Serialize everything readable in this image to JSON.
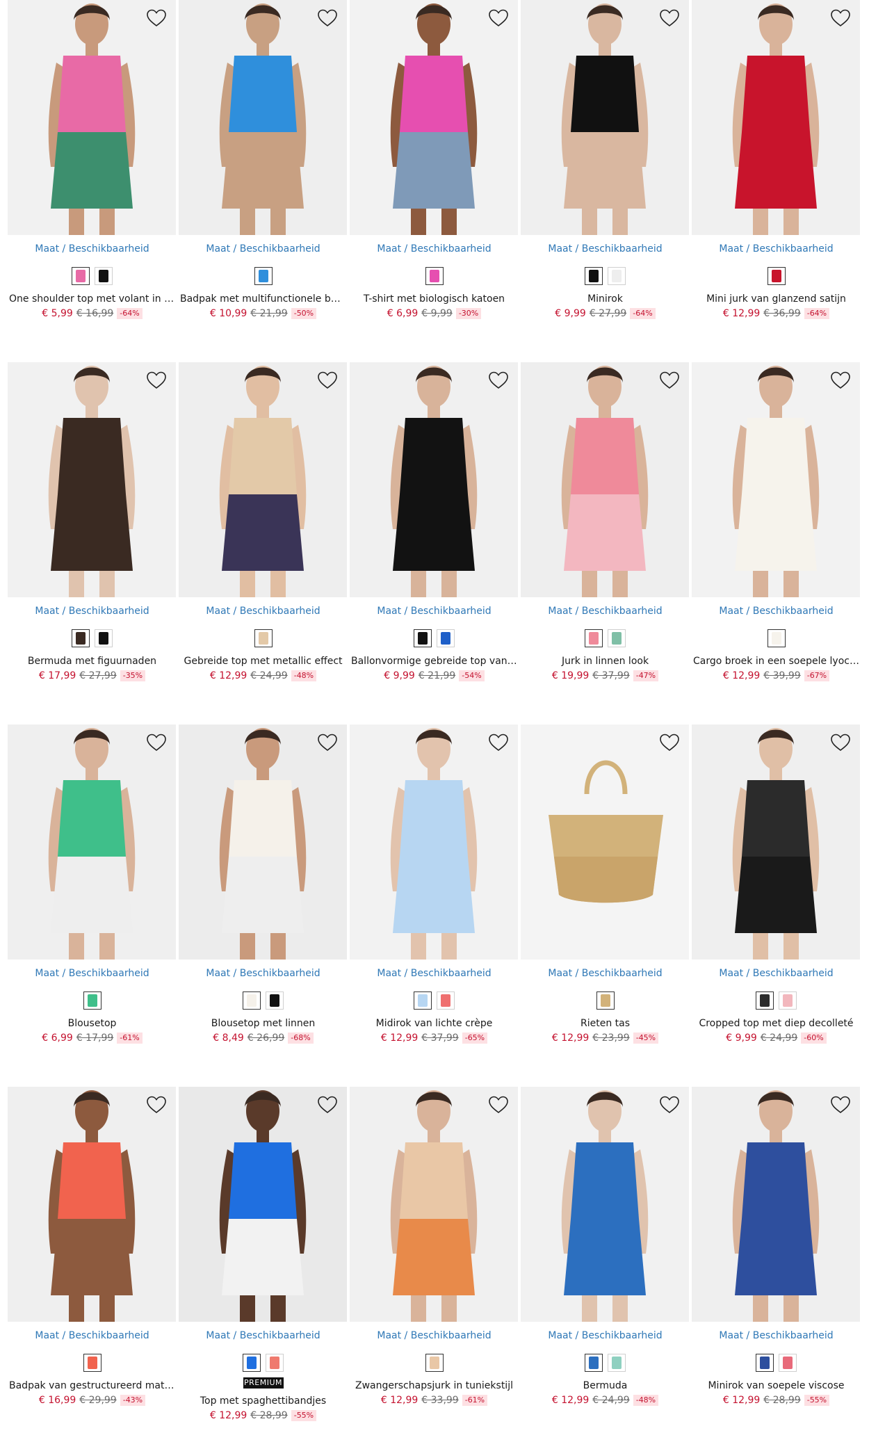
{
  "labels": {
    "size_availability": "Maat / Beschikbaarheid",
    "premium": "PREMIUM"
  },
  "colors": {
    "link": "#2f78b6",
    "sale_price": "#c4122f",
    "discount_bg": "#fde0e3"
  },
  "products": [
    {
      "name": "One shoulder top met volant in een...",
      "price": "€ 5,99",
      "old_price": "€ 16,99",
      "discount": "-64%",
      "photo_bg": "#f1f1f1",
      "garment": "#e86aa6",
      "skin": "#c89a7c",
      "lower": "#3d8f6e",
      "swatches": [
        "#e86aa6",
        "#111111"
      ]
    },
    {
      "name": "Badpak met multifunctionele bandjes",
      "price": "€ 10,99",
      "old_price": "€ 21,99",
      "discount": "-50%",
      "photo_bg": "#eeeeee",
      "garment": "#2f8fdc",
      "skin": "#c8a082",
      "lower": "#c8a082",
      "swatches": [
        "#2f8fdc"
      ]
    },
    {
      "name": "T-shirt met biologisch katoen",
      "price": "€ 6,99",
      "old_price": "€ 9,99",
      "discount": "-30%",
      "photo_bg": "#f2f2f2",
      "garment": "#e64fb0",
      "skin": "#8d5a3e",
      "lower": "#7f9ab8",
      "swatches": [
        "#e64fb0"
      ]
    },
    {
      "name": "Minirok",
      "price": "€ 9,99",
      "old_price": "€ 27,99",
      "discount": "-64%",
      "photo_bg": "#efefef",
      "garment": "#111111",
      "skin": "#d9b7a0",
      "lower": "#d9b7a0",
      "swatches": [
        "#111111",
        "#eeeeee"
      ]
    },
    {
      "name": "Mini jurk van glanzend satijn",
      "price": "€ 12,99",
      "old_price": "€ 36,99",
      "discount": "-64%",
      "photo_bg": "#f0f0f0",
      "garment": "#c8142c",
      "skin": "#d9b39a",
      "lower": "#c8142c",
      "swatches": [
        "#c8142c"
      ]
    },
    {
      "name": "Bermuda met figuurnaden",
      "price": "€ 17,99",
      "old_price": "€ 27,99",
      "discount": "-35%",
      "photo_bg": "#f1f1f1",
      "garment": "#3a2a22",
      "skin": "#e0c3ae",
      "lower": "#3a2a22",
      "swatches": [
        "#3a2a22",
        "#111111"
      ]
    },
    {
      "name": "Gebreide top met metallic effect",
      "price": "€ 12,99",
      "old_price": "€ 24,99",
      "discount": "-48%",
      "photo_bg": "#eeeeee",
      "garment": "#e3c9a8",
      "skin": "#e1bea2",
      "lower": "#3a3457",
      "swatches": [
        "#e3c9a8"
      ]
    },
    {
      "name": "Ballonvormige gebreide top van fij...",
      "price": "€ 9,99",
      "old_price": "€ 21,99",
      "discount": "-54%",
      "photo_bg": "#f0f0f0",
      "garment": "#121212",
      "skin": "#d8b39a",
      "lower": "#121212",
      "swatches": [
        "#121212",
        "#1e5fc8"
      ]
    },
    {
      "name": "Jurk in linnen look",
      "price": "€ 19,99",
      "old_price": "€ 37,99",
      "discount": "-47%",
      "photo_bg": "#eeeeee",
      "garment": "#ef8a9a",
      "skin": "#d9b39a",
      "lower": "#f3b7c0",
      "swatches": [
        "#ef8a9a",
        "#7fbfa6"
      ]
    },
    {
      "name": "Cargo broek in een soepele lyocell...",
      "price": "€ 12,99",
      "old_price": "€ 39,99",
      "discount": "-67%",
      "photo_bg": "#f2f2f2",
      "garment": "#f6f3ec",
      "skin": "#d9b39a",
      "lower": "#f6f3ec",
      "swatches": [
        "#f6f3ec"
      ]
    },
    {
      "name": "Blousetop",
      "price": "€ 6,99",
      "old_price": "€ 17,99",
      "discount": "-61%",
      "photo_bg": "#efefef",
      "garment": "#3fbf8a",
      "skin": "#d9b39a",
      "lower": "#eeeeee",
      "swatches": [
        "#3fbf8a"
      ]
    },
    {
      "name": "Blousetop met linnen",
      "price": "€ 8,49",
      "old_price": "€ 26,99",
      "discount": "-68%",
      "photo_bg": "#ececec",
      "garment": "#f5f1ea",
      "skin": "#c99a7c",
      "lower": "#eeeeee",
      "swatches": [
        "#f5f1ea",
        "#111111"
      ]
    },
    {
      "name": "Midirok van lichte crèpe",
      "price": "€ 12,99",
      "old_price": "€ 37,99",
      "discount": "-65%",
      "photo_bg": "#f2f2f2",
      "garment": "#b7d6f2",
      "skin": "#e2c3ad",
      "lower": "#b7d6f2",
      "swatches": [
        "#b7d6f2",
        "#ef6f6f"
      ]
    },
    {
      "name": "Rieten tas",
      "price": "€ 12,99",
      "old_price": "€ 23,99",
      "discount": "-45%",
      "photo_bg": "#f4f4f4",
      "garment": "#d2b27a",
      "skin": "#d2b27a",
      "lower": "#c9a46a",
      "swatches": [
        "#d2b27a"
      ]
    },
    {
      "name": "Cropped top met diep decolleté",
      "price": "€ 9,99",
      "old_price": "€ 24,99",
      "discount": "-60%",
      "photo_bg": "#efefef",
      "garment": "#2b2b2b",
      "skin": "#e0bfa6",
      "lower": "#1a1a1a",
      "swatches": [
        "#2b2b2b",
        "#f2b7bd"
      ]
    },
    {
      "name": "Badpak van gestructureerd materia...",
      "price": "€ 16,99",
      "old_price": "€ 29,99",
      "discount": "-43%",
      "photo_bg": "#efefef",
      "garment": "#f1634e",
      "skin": "#8d5a3e",
      "lower": "#8d5a3e",
      "swatches": [
        "#f1634e"
      ]
    },
    {
      "name": "Top met spaghettibandjes",
      "price": "€ 12,99",
      "old_price": "€ 28,99",
      "discount": "-55%",
      "photo_bg": "#e9e9e9",
      "garment": "#1f6fe0",
      "skin": "#5a3a2a",
      "lower": "#f2f2f2",
      "swatches": [
        "#1f6fe0",
        "#ef7a6e"
      ],
      "premium": true
    },
    {
      "name": "Zwangerschapsjurk in tuniekstijl",
      "price": "€ 12,99",
      "old_price": "€ 33,99",
      "discount": "-61%",
      "photo_bg": "#f0f0f0",
      "garment": "#e9c7a6",
      "skin": "#d9b39a",
      "lower": "#e88a4a",
      "swatches": [
        "#e9c7a6"
      ]
    },
    {
      "name": "Bermuda",
      "price": "€ 12,99",
      "old_price": "€ 24,99",
      "discount": "-48%",
      "photo_bg": "#f1f1f1",
      "garment": "#2c6fbf",
      "skin": "#e0c3ae",
      "lower": "#2c6fbf",
      "swatches": [
        "#2c6fbf",
        "#8fd0c0"
      ]
    },
    {
      "name": "Minirok van soepele viscose",
      "price": "€ 12,99",
      "old_price": "€ 28,99",
      "discount": "-55%",
      "photo_bg": "#efefef",
      "garment": "#2e4f9e",
      "skin": "#d9b39a",
      "lower": "#2e4f9e",
      "swatches": [
        "#2e4f9e",
        "#e86a7a"
      ]
    }
  ]
}
